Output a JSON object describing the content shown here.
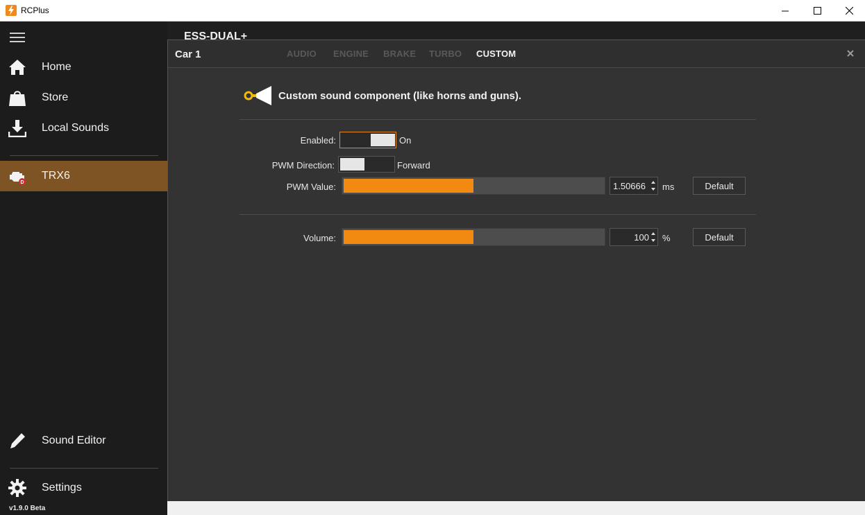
{
  "window": {
    "title": "RCPlus"
  },
  "sidebar": {
    "items": [
      {
        "label": "Home",
        "icon": "home-icon"
      },
      {
        "label": "Store",
        "icon": "shopping-bag-icon"
      },
      {
        "label": "Local Sounds",
        "icon": "download-icon"
      },
      {
        "label": "TRX6",
        "icon": "engine-icon",
        "active": true
      },
      {
        "label": "Sound Editor",
        "icon": "pencil-icon"
      },
      {
        "label": "Settings",
        "icon": "gear-icon"
      }
    ],
    "version": "v1.9.0 Beta"
  },
  "background_page": {
    "title": "ESS-DUAL+"
  },
  "dialog": {
    "title": "Car 1",
    "tabs": [
      {
        "label": "AUDIO"
      },
      {
        "label": "ENGINE"
      },
      {
        "label": "BRAKE"
      },
      {
        "label": "TURBO"
      },
      {
        "label": "CUSTOM",
        "active": true
      }
    ],
    "section_title": "Custom sound component (like horns and guns).",
    "enabled": {
      "label": "Enabled:",
      "state": "On",
      "on": true
    },
    "pwm_direction": {
      "label": "PWM Direction:",
      "state": "Forward"
    },
    "pwm_value": {
      "label": "PWM Value:",
      "value": "1.50666",
      "unit": "ms",
      "fill_fraction": 0.5,
      "default_label": "Default"
    },
    "volume": {
      "label": "Volume:",
      "value": "100",
      "unit": "%",
      "fill_fraction": 0.5,
      "default_label": "Default"
    }
  },
  "colors": {
    "accent": "#f28a12",
    "active_nav": "#7f5424",
    "horn": "#f2b90f"
  }
}
